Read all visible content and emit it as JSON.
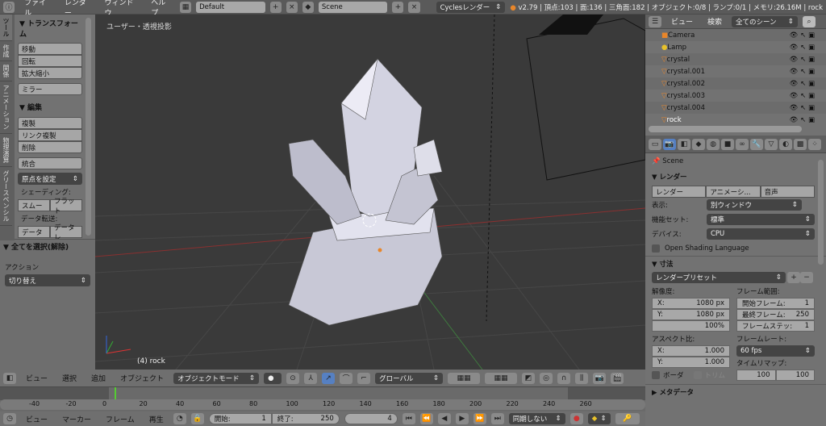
{
  "top": {
    "menus": [
      "ファイル",
      "レンダー",
      "ウィンドウ",
      "ヘルプ"
    ],
    "layout": "Default",
    "scene": "Scene",
    "engine": "Cyclesレンダー",
    "status": "v2.79 | 頂点:103 | 面:136 | 三角面:182 | オブジェクト:0/8 | ランプ:0/1 | メモリ:26.16M | rock"
  },
  "shelf": {
    "tabs": [
      "ツール",
      "作成",
      "関係",
      "アニメーション",
      "物理演算",
      "グリースペンシル"
    ],
    "transform": "▼ トランスフォーム",
    "move": "移動",
    "rotate": "回転",
    "scale": "拡大縮小",
    "mirror": "ミラー",
    "edit": "▼ 編集",
    "duplicate": "複製",
    "link_dup": "リンク複製",
    "delete": "削除",
    "join": "統合",
    "origin": "原点を設定",
    "shading": "シェーディング:",
    "smooth": "スムー",
    "flat": "フラット",
    "transfer": "データ転送:",
    "data": "データ",
    "data_l": "データレ",
    "select_all": "▼ 全てを選択(解除)",
    "action": "アクション",
    "toggle": "切り替え"
  },
  "viewport": {
    "label": "ユーザー・透視投影",
    "object": "(4) rock"
  },
  "outliner": {
    "view": "ビュー",
    "search": "検索",
    "scenes": "全てのシーン",
    "items": [
      "Camera",
      "Lamp",
      "crystal",
      "crystal.001",
      "crystal.002",
      "crystal.003",
      "crystal.004",
      "rock"
    ]
  },
  "props": {
    "scene": "Scene",
    "render_panel": "▼ レンダー",
    "render_btn": "レンダー",
    "anim_btn": "アニメーシ...",
    "audio_btn": "音声",
    "display_l": "表示:",
    "display": "別ウィンドウ",
    "featureset_l": "機能セット:",
    "featureset": "標準",
    "device_l": "デバイス:",
    "device": "CPU",
    "osl": "Open Shading Language",
    "dims": "▼ 寸法",
    "preset": "レンダープリセット",
    "res": "解像度:",
    "rx_l": "X:",
    "rx": "1080 px",
    "ry_l": "Y:",
    "ry": "1080 px",
    "pct": "100%",
    "frange": "フレーム範囲:",
    "fstart_l": "開始フレーム:",
    "fstart": "1",
    "fend_l": "最終フレーム:",
    "fend": "250",
    "fstep_l": "フレームステッ:",
    "fstep": "1",
    "aspect": "アスペクト比:",
    "ax_l": "X:",
    "ax": "1.000",
    "ay_l": "Y:",
    "ay": "1.000",
    "border": "ボーダ",
    "crop": "トリム",
    "framerate_l": "フレームレート:",
    "framerate": "60 fps",
    "remap": "タイムリマップ:",
    "remap_old": "100",
    "remap_new": "100",
    "meta": "▶ メタデータ"
  },
  "vp_header": {
    "menus": [
      "ビュー",
      "選択",
      "追加",
      "オブジェクト"
    ],
    "mode": "オブジェクトモード",
    "orient": "グローバル"
  },
  "timeline": {
    "ticks": [
      "-40",
      "-20",
      "0",
      "20",
      "40",
      "60",
      "80",
      "100",
      "120",
      "140",
      "160",
      "180",
      "200",
      "220",
      "240",
      "260"
    ],
    "current_frame": 4,
    "menus": [
      "ビュー",
      "マーカー",
      "フレーム",
      "再生"
    ],
    "start_l": "開始:",
    "start": "1",
    "end_l": "終了:",
    "end": "250",
    "frame": "4",
    "sync": "同期しない"
  }
}
